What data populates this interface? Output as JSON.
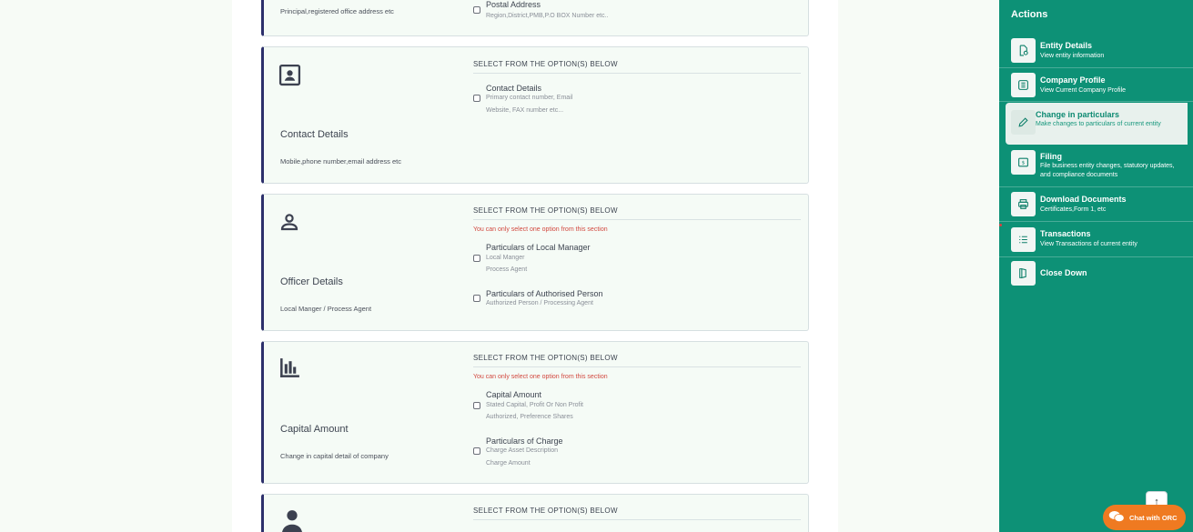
{
  "sections": {
    "address": {
      "left_sub": "Principal,registered office address etc",
      "options": [
        {
          "title": "Postal Address",
          "sub1": "Region,District,PMB,P.O BOX Number etc..",
          "sub2": ""
        }
      ]
    },
    "contact": {
      "heading": "SELECT FROM THE OPTION(S) BELOW",
      "title": "Contact Details",
      "sub": "Mobile,phone number,email address etc",
      "options": [
        {
          "title": "Contact Details",
          "sub1": "Primary contact number, Email",
          "sub2": "Website, FAX number etc..."
        }
      ]
    },
    "officer": {
      "heading": "SELECT FROM THE OPTION(S) BELOW",
      "warning": "You can only select one option from this section",
      "title": "Officer Details",
      "sub": "Local Manger / Process Agent",
      "options": [
        {
          "title": "Particulars of Local Manager",
          "sub1": "Local Manger",
          "sub2": "Process Agent"
        },
        {
          "title": "Particulars of Authorised Person",
          "sub1": "Authorized Person / Processing Agent",
          "sub2": ""
        }
      ]
    },
    "capital": {
      "heading": "SELECT FROM THE OPTION(S) BELOW",
      "warning": "You can only select one option from this section",
      "title": "Capital Amount",
      "sub": "Change in capital detail of company",
      "options": [
        {
          "title": "Capital Amount",
          "sub1": "Stated Capital, Profit Or Non Profit",
          "sub2": "Authorized, Preference Shares"
        },
        {
          "title": "Particulars of Charge",
          "sub1": "Charge Asset Description",
          "sub2": "Charge Amount"
        }
      ]
    },
    "next": {
      "heading": "SELECT FROM THE OPTION(S) BELOW"
    }
  },
  "sidebar": {
    "title": "Actions",
    "items": [
      {
        "title": "Entity Details",
        "sub": "View entity information",
        "icon": "document-search-icon"
      },
      {
        "title": "Company Profile",
        "sub": "View Current Company Profile",
        "icon": "list-box-icon"
      },
      {
        "title": "Change in particulars",
        "sub": "Make changes to particulars of current entity",
        "icon": "pencil-icon"
      },
      {
        "title": "Filing",
        "sub": "File business entity changes, statutory updates, and compliance documents",
        "icon": "money-file-icon"
      },
      {
        "title": "Download Documents",
        "sub": "Certificates,Form 1, etc",
        "icon": "printer-icon"
      },
      {
        "title": "Transactions",
        "sub": "View Transactions of current entity",
        "icon": "list-lines-icon"
      },
      {
        "title": "Close Down",
        "sub": "",
        "icon": "close-down-icon"
      }
    ]
  },
  "chat": {
    "label": "Chat with ORC"
  },
  "colors": {
    "sidebar": "#0d9176",
    "card_border": "#2c2f6b",
    "warning": "#d2483f",
    "chat": "#ef7a21"
  }
}
